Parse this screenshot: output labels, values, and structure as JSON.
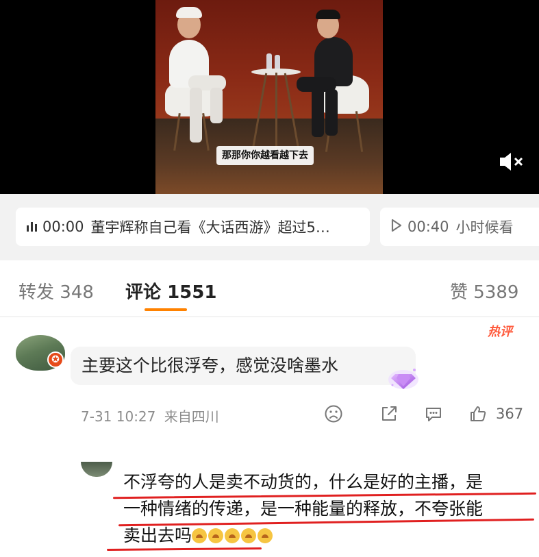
{
  "video": {
    "subtitle": "那那你你越看越下去",
    "mute_icon": "speaker-muted-icon"
  },
  "chapters": [
    {
      "time": "00:00",
      "title": "董宇辉称自己看《大话西游》超过5…",
      "icon": "audio-bars-icon"
    },
    {
      "time": "00:40",
      "title": "小时候看",
      "icon": "play-icon"
    }
  ],
  "tabs": {
    "repost": {
      "label": "转发",
      "count": "348"
    },
    "comments": {
      "label": "评论",
      "count": "1551"
    },
    "likes": {
      "label": "赞",
      "count": "5389"
    }
  },
  "comment": {
    "hot_badge": "热评",
    "text": "主要这个比很浮夸，感觉没啥墨水",
    "date": "7-31 10:27",
    "location": "来自四川",
    "like_count": "367",
    "actions": [
      "dislike-face-icon",
      "share-icon",
      "reply-icon",
      "thumbs-up-icon"
    ]
  },
  "reply": {
    "line1": "不浮夸的人是卖不动货的，什么是好的主播，是",
    "line2": "一种情绪的传递，是一种能量的释放，不夸张能",
    "line3": "卖出去吗",
    "emoji_count": 5
  },
  "colors": {
    "accent": "#ff8200",
    "hot": "#ff5a3c",
    "annotation": "#e02020"
  }
}
